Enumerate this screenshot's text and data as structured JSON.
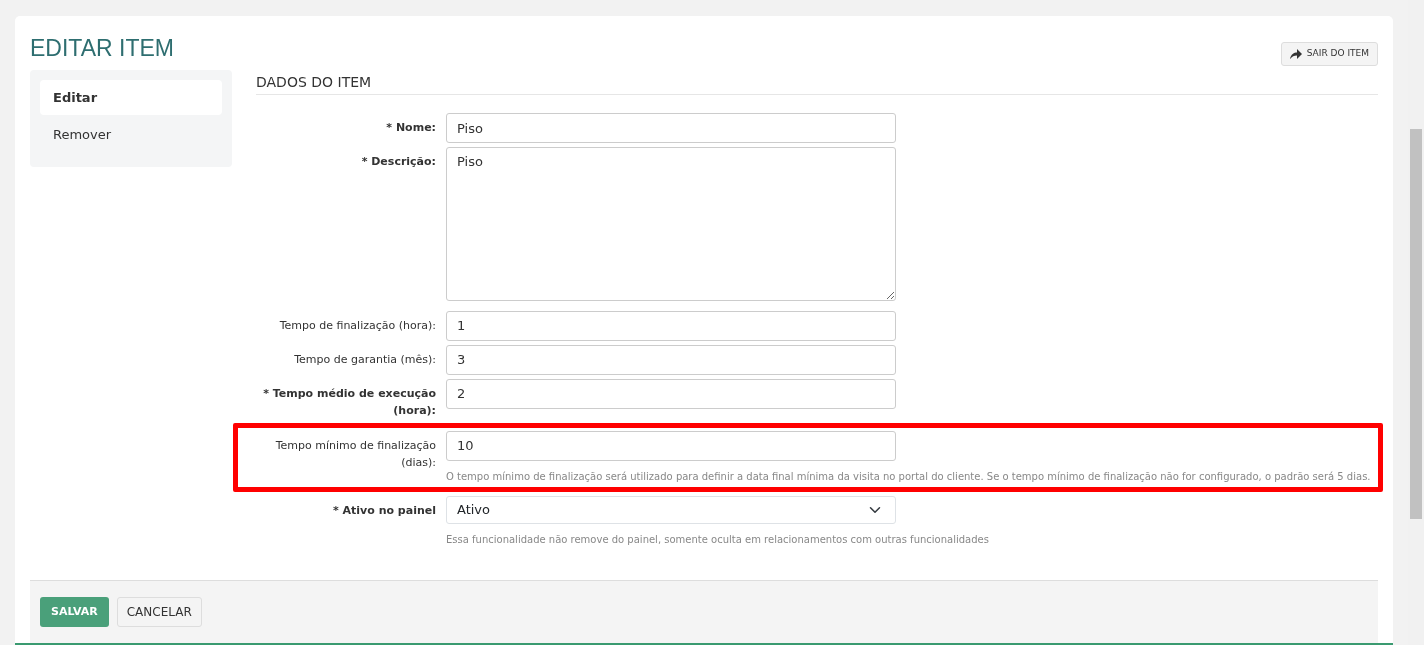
{
  "page_title": "EDITAR ITEM",
  "exit_button": {
    "label": "SAIR DO ITEM"
  },
  "sidebar": {
    "items": [
      {
        "label": "Editar",
        "selected": true
      },
      {
        "label": "Remover",
        "selected": false
      }
    ]
  },
  "section_title": "DADOS DO ITEM",
  "fields": [
    {
      "kind": "input",
      "label": "* Nome:",
      "required": true,
      "value": "Piso",
      "highlighted": false
    },
    {
      "kind": "textarea",
      "label": "* Descrição:",
      "required": true,
      "value": "Piso",
      "highlighted": false
    },
    {
      "kind": "input",
      "label": "Tempo de finalização (hora):",
      "required": false,
      "value": "1",
      "highlighted": false
    },
    {
      "kind": "input",
      "label": "Tempo de garantia (mês):",
      "required": false,
      "value": "3",
      "highlighted": false
    },
    {
      "kind": "input",
      "label": "* Tempo médio de execução (hora):",
      "required": true,
      "value": "2",
      "highlighted": false
    },
    {
      "kind": "input",
      "label": "Tempo mínimo de finalização (dias):",
      "required": false,
      "value": "10",
      "highlighted": true,
      "help": "O tempo mínimo de finalização será utilizado para definir a data final mínima da visita no portal do cliente. Se o tempo mínimo de finalização não for configurado, o padrão será 5 dias."
    },
    {
      "kind": "select",
      "label": "* Ativo no painel",
      "required": true,
      "value": "Ativo",
      "highlighted": false,
      "help": "Essa funcionalidade não remove do painel, somente oculta em relacionamentos com outras funcionalidades"
    }
  ],
  "footer_buttons": [
    {
      "kind": "primary",
      "label": "SALVAR"
    },
    {
      "kind": "secondary",
      "label": "CANCELAR"
    }
  ]
}
